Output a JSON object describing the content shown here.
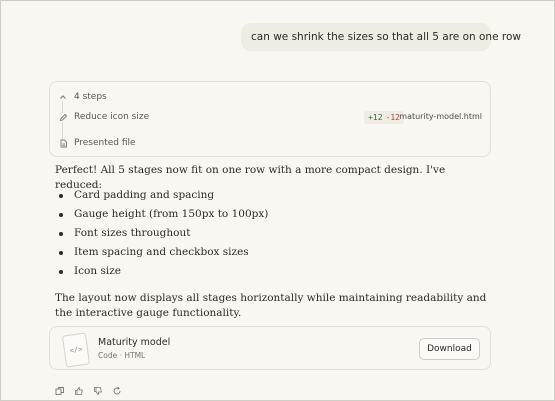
{
  "user_message": "can we shrink the sizes so that all 5 are on one row",
  "steps": {
    "header": "4 steps",
    "items": [
      {
        "label": "Reduce icon size",
        "diff_added": "+12",
        "diff_removed": "-12",
        "file": "maturity-model.html"
      },
      {
        "label": "Presented file"
      }
    ]
  },
  "response": {
    "intro": "Perfect! All 5 stages now fit on one row with a more compact design. I've reduced:",
    "bullets": [
      "Card padding and spacing",
      "Gauge height (from 150px to 100px)",
      "Font sizes throughout",
      "Item spacing and checkbox sizes",
      "Icon size"
    ],
    "outro": "The layout now displays all stages horizontally while maintaining readability and the interactive gauge functionality."
  },
  "artifact": {
    "title": "Maturity model",
    "meta": "Code · HTML",
    "thumb_glyph": "</>",
    "download_label": "Download"
  },
  "icons": {
    "chevron": "chevron-up-icon",
    "pencil": "pencil-icon",
    "file": "file-icon",
    "copy": "copy-icon",
    "thumbs_up": "thumbs-up-icon",
    "thumbs_down": "thumbs-down-icon",
    "retry": "retry-icon"
  }
}
